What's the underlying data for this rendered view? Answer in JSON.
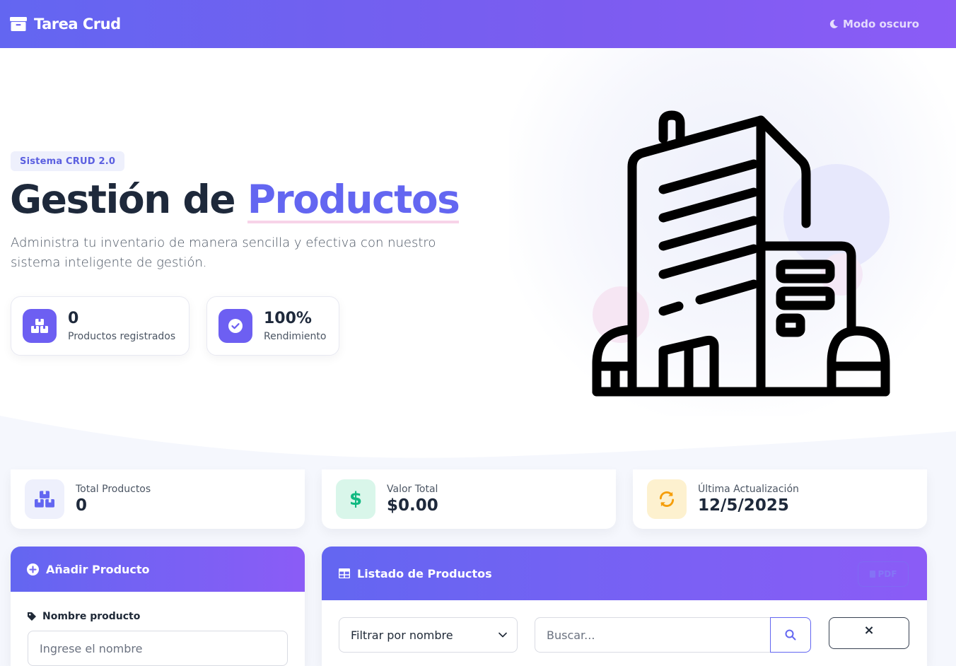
{
  "navbar": {
    "brand": "Tarea Crud",
    "dark_mode_label": "Modo oscuro"
  },
  "hero": {
    "badge": "Sistema CRUD 2.0",
    "title_part1": "Gestión de ",
    "title_accent": "Productos",
    "description": "Administra tu inventario de manera sencilla y efectiva con nuestro sistema inteligente de gestión.",
    "mini_cards": [
      {
        "value": "0",
        "label": "Productos registrados"
      },
      {
        "value": "100%",
        "label": "Rendimiento"
      }
    ]
  },
  "stats": [
    {
      "label": "Total Productos",
      "value": "0",
      "icon": "boxes-icon"
    },
    {
      "label": "Valor Total",
      "value": "$0.00",
      "icon": "dollar-icon"
    },
    {
      "label": "Última Actualización",
      "value": "12/5/2025",
      "icon": "sync-icon"
    }
  ],
  "add_panel": {
    "title": "Añadir Producto",
    "name_label": "Nombre producto",
    "name_placeholder": "Ingrese el nombre"
  },
  "list_panel": {
    "title": "Listado de Productos",
    "pdf_label": "PDF",
    "filter_selected": "Filtrar por nombre",
    "search_placeholder": "Buscar...",
    "clear_label": "×"
  },
  "colors": {
    "primary": "#6366f1",
    "secondary": "#8b5cf6",
    "success": "#10b981",
    "warning": "#f59e0b"
  }
}
